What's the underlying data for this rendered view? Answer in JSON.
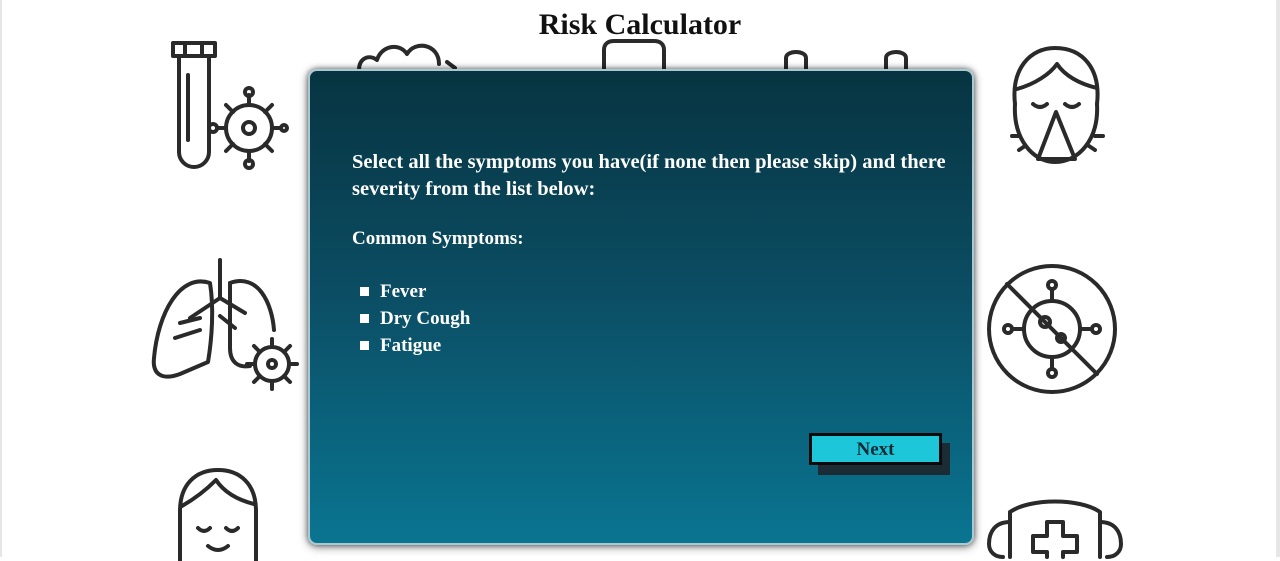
{
  "page": {
    "title": "Risk Calculator"
  },
  "dialog": {
    "instructions": "Select all the symptoms you have(if none then please skip) and there severity from the list below:",
    "section_heading": "Common Symptoms:",
    "symptoms": [
      "Fever",
      "Dry Cough",
      "Fatigue"
    ],
    "next_label": "Next"
  },
  "background_icons": [
    "test-tube-virus-icon",
    "lungs-virus-icon",
    "face-mask-icon",
    "sneezing-face-icon",
    "no-virus-icon",
    "medical-mask-icon"
  ],
  "colors": {
    "dialog_top": "#073441",
    "dialog_bottom": "#0a7591",
    "button_fill": "#1ec6d9",
    "icon_stroke": "#2a2a2a"
  }
}
